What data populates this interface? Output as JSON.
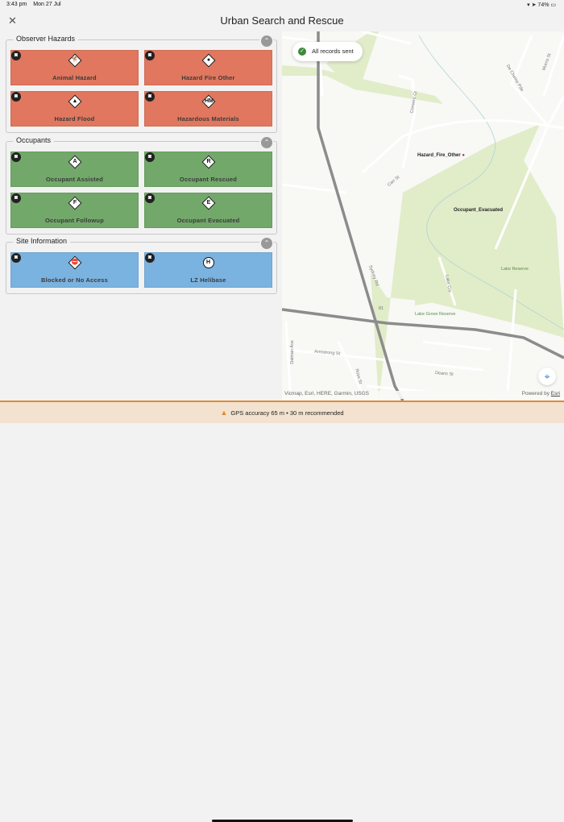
{
  "status_bar": {
    "time": "3:43 pm",
    "date": "Mon 27 Jul",
    "battery": "74%"
  },
  "header": {
    "title": "Urban Search and Rescue",
    "close_icon": "close-icon"
  },
  "sections": [
    {
      "title": "Observer Hazards",
      "color": "#e0775e",
      "tiles": [
        {
          "label": "Animal Hazard",
          "glyph": "🐕",
          "shape": "diamond"
        },
        {
          "label": "Hazard Fire Other",
          "glyph": "●",
          "shape": "diamond"
        },
        {
          "label": "Hazard Flood",
          "glyph": "▲",
          "shape": "diamond"
        },
        {
          "label": "Hazardous Materials",
          "glyph": "HM",
          "shape": "diamond"
        }
      ]
    },
    {
      "title": "Occupants",
      "color": "#72a86a",
      "tiles": [
        {
          "label": "Occupant Assisted",
          "glyph": "A",
          "shape": "diamond"
        },
        {
          "label": "Occupant Rescued",
          "glyph": "R",
          "shape": "diamond"
        },
        {
          "label": "Occupant Followup",
          "glyph": "F",
          "shape": "diamond"
        },
        {
          "label": "Occupant Evacuated",
          "glyph": "E",
          "shape": "diamond"
        }
      ]
    },
    {
      "title": "Site Information",
      "color": "#7ab2e0",
      "tiles": [
        {
          "label": "Blocked or No Access",
          "glyph": "⛔",
          "shape": "diamond"
        },
        {
          "label": "LZ Helibase",
          "glyph": "H",
          "shape": "circle"
        }
      ]
    }
  ],
  "map": {
    "toast": "All records sent",
    "features": [
      {
        "label": "Hazard_Fire_Other",
        "color": "#a0336b"
      },
      {
        "label": "Occupant_Evacuated",
        "color": "#3aa8a0"
      }
    ],
    "streets": [
      "Carr St",
      "Convent Ct",
      "De Cheine Pde",
      "Morris St",
      "Sydney Rd",
      "Lake Reserve",
      "Lake Grove Reserve",
      "Lake Crv",
      "Armstrong St",
      "Ross St",
      "Deans St",
      "Dalman Ave",
      "81"
    ],
    "attribution": "Vicmap, Esri, HERE, Garmin, USGS",
    "powered_by": "Powered by",
    "esri_link": "Esri"
  },
  "banner": {
    "text": "GPS accuracy 65 m  •  30 m recommended"
  }
}
